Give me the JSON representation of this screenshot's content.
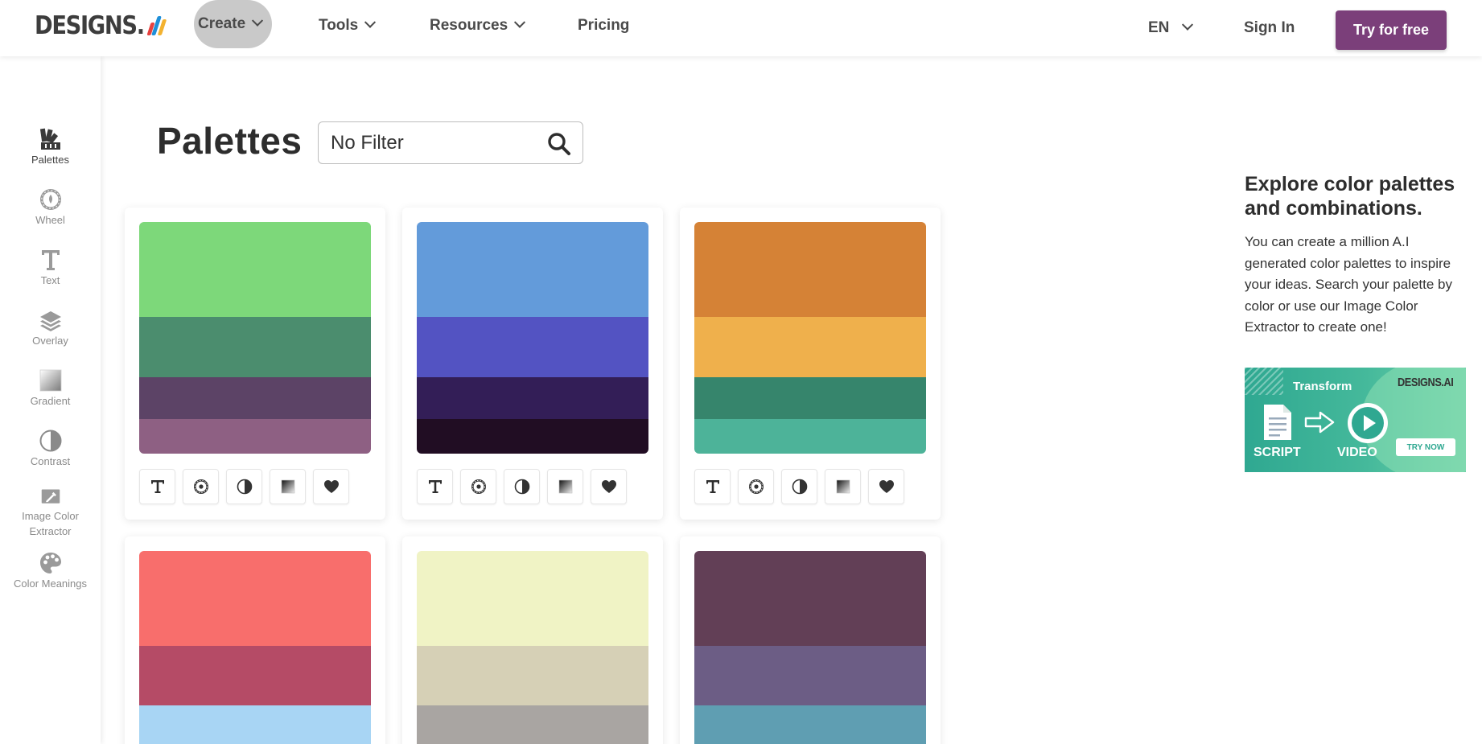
{
  "nav": {
    "logo_text": "DESIGNS.",
    "items": [
      {
        "label": "Create",
        "has_dropdown": true,
        "active": true
      },
      {
        "label": "Tools",
        "has_dropdown": true
      },
      {
        "label": "Resources",
        "has_dropdown": true
      },
      {
        "label": "Pricing",
        "has_dropdown": false
      }
    ],
    "language": "EN",
    "sign_in": "Sign In",
    "try_button": "Try for free",
    "accent_color": "#7b3f7a"
  },
  "sidebar": {
    "items": [
      {
        "label": "Palettes",
        "icon": "palettes-icon",
        "active": true
      },
      {
        "label": "Wheel",
        "icon": "color-wheel-icon"
      },
      {
        "label": "Text",
        "icon": "text-icon"
      },
      {
        "label": "Overlay",
        "icon": "layers-icon"
      },
      {
        "label": "Gradient",
        "icon": "gradient-icon"
      },
      {
        "label": "Contrast",
        "icon": "contrast-icon"
      },
      {
        "label": "Image Color Extractor",
        "label_line1": "Image Color",
        "label_line2": "Extractor",
        "icon": "eyedropper-icon"
      },
      {
        "label": "Color Meanings",
        "icon": "paint-palette-icon"
      }
    ]
  },
  "main": {
    "title": "Palettes",
    "filter": {
      "value": "No Filter",
      "icon": "search-icon"
    },
    "palettes": [
      {
        "colors": [
          "#7dd87a",
          "#4b8d6e",
          "#5c4366",
          "#8e6083"
        ]
      },
      {
        "colors": [
          "#639bda",
          "#5353c2",
          "#331e57",
          "#210d23"
        ]
      },
      {
        "colors": [
          "#d58236",
          "#efb04c",
          "#36856c",
          "#4db399"
        ]
      },
      {
        "colors": [
          "#f86e6c",
          "#b54b66",
          "#a8d5f4"
        ]
      },
      {
        "colors": [
          "#f0f3c5",
          "#d6d0b6",
          "#a9a5a2"
        ]
      },
      {
        "colors": [
          "#623f56",
          "#6c5d85",
          "#5f9eb2"
        ]
      }
    ],
    "card_actions": [
      "text-icon",
      "color-wheel-icon",
      "contrast-icon",
      "gradient-icon",
      "heart-icon"
    ]
  },
  "right_panel": {
    "title": "Explore color palettes and combinations.",
    "body": "You can create a million A.I generated color palettes to inspire your ideas. Search your palette by color or use our Image Color Extractor to create one!",
    "promo": {
      "title": "Transform",
      "brand": "DESIGNS.AI",
      "from": "SCRIPT",
      "to": "VIDEO",
      "button": "TRY NOW"
    }
  }
}
